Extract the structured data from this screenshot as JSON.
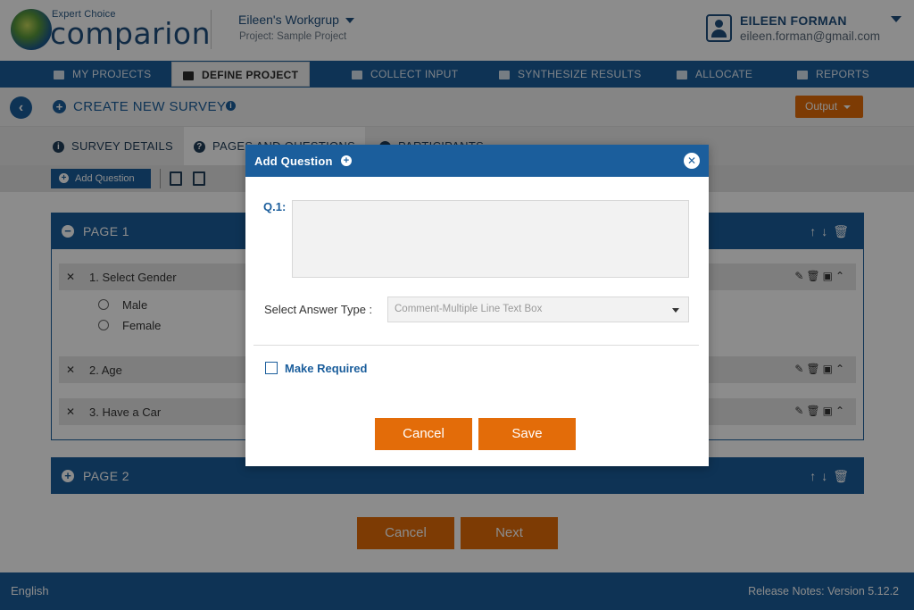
{
  "header": {
    "logo_small": "Expert Choice",
    "logo_big": "comparion",
    "workgroup": "Eileen's Workgrup",
    "project": "Project: Sample Project",
    "user_name": "EILEEN FORMAN",
    "user_email": "eileen.forman@gmail.com"
  },
  "nav": {
    "items": [
      {
        "label": "MY PROJECTS",
        "icon": "folder-icon"
      },
      {
        "label": "DEFINE PROJECT",
        "icon": "document-icon"
      },
      {
        "label": "COLLECT INPUT",
        "icon": "bar-chart-icon"
      },
      {
        "label": "SYNTHESIZE RESULTS",
        "icon": "database-icon"
      },
      {
        "label": "ALLOCATE",
        "icon": "pie-chart-icon"
      },
      {
        "label": "REPORTS",
        "icon": "reports-icon"
      }
    ],
    "active": "DEFINE PROJECT"
  },
  "subheader": {
    "title": "CREATE NEW SURVEY",
    "output_label": "Output"
  },
  "tabs": [
    {
      "label": "SURVEY DETAILS"
    },
    {
      "label": "PAGES AND QUESTIONS"
    },
    {
      "label": "PARTICIPANTS"
    }
  ],
  "toolbar": {
    "add_question_label": "Add Question"
  },
  "pages": [
    {
      "title": "PAGE 1",
      "questions": [
        {
          "text": "1. Select Gender",
          "options": [
            "Male",
            "Female"
          ]
        },
        {
          "text": "2. Age"
        },
        {
          "text": "3. Have a Car"
        }
      ]
    },
    {
      "title": "PAGE 2"
    }
  ],
  "footer_buttons": {
    "cancel": "Cancel",
    "next": "Next"
  },
  "footer": {
    "language": "English",
    "release_notes": "Release Notes:  Version 5.12.2"
  },
  "modal": {
    "title": "Add Question",
    "question_label": "Q.1:",
    "question_value": "",
    "answer_type_label": "Select Answer Type :",
    "answer_type_value": "Comment-Multiple Line Text Box",
    "make_required_label": "Make Required",
    "make_required_checked": false,
    "cancel_label": "Cancel",
    "save_label": "Save"
  },
  "colors": {
    "brand_blue": "#1b5e9c",
    "accent_orange": "#e36c09"
  }
}
